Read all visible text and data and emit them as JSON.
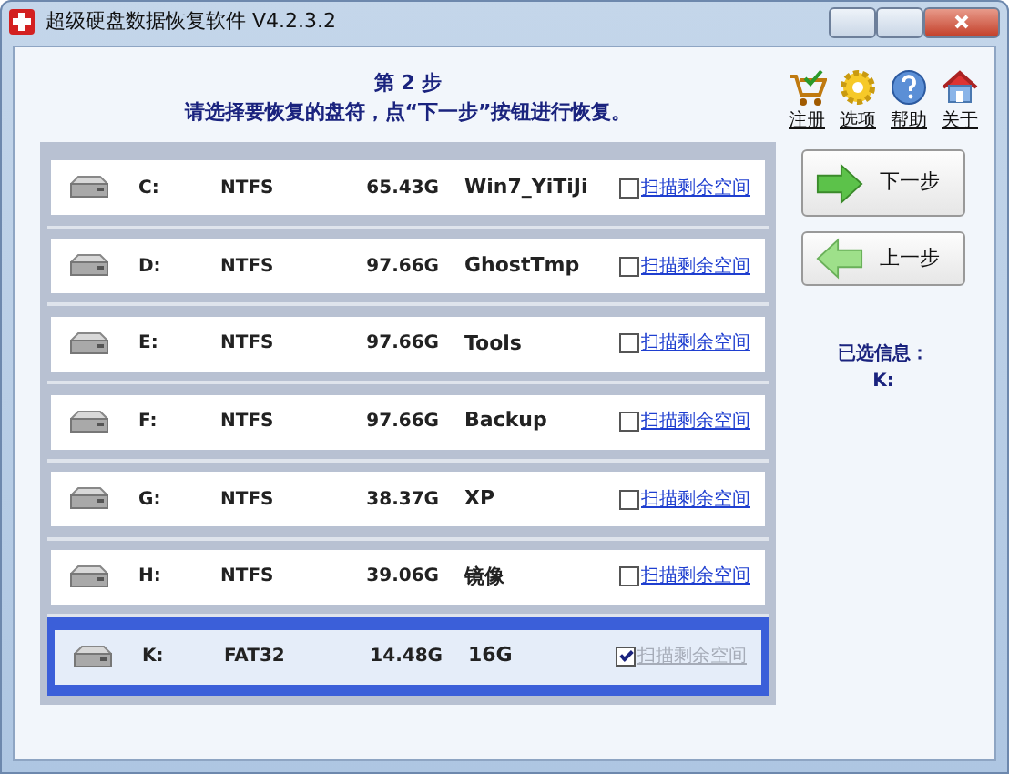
{
  "window": {
    "title": "超级硬盘数据恢复软件 V4.2.3.2"
  },
  "header": {
    "step": "第 2 步",
    "instruction": "请选择要恢复的盘符，点“下一步”按钮进行恢复。"
  },
  "toolbar": [
    {
      "kind": "cart",
      "label": "注册"
    },
    {
      "kind": "gear",
      "label": "选项"
    },
    {
      "kind": "help",
      "label": "帮助"
    },
    {
      "kind": "home",
      "label": "关于"
    }
  ],
  "drives": [
    {
      "letter": "C:",
      "filesystem": "NTFS",
      "size": "65.43G",
      "label": "Win7_YiTiJi",
      "selected": false,
      "scan_free_space": {
        "label": "扫描剩余空间",
        "checked": false,
        "disabled": false
      }
    },
    {
      "letter": "D:",
      "filesystem": "NTFS",
      "size": "97.66G",
      "label": "GhostTmp",
      "selected": false,
      "scan_free_space": {
        "label": "扫描剩余空间",
        "checked": false,
        "disabled": false
      }
    },
    {
      "letter": "E:",
      "filesystem": "NTFS",
      "size": "97.66G",
      "label": "Tools",
      "selected": false,
      "scan_free_space": {
        "label": "扫描剩余空间",
        "checked": false,
        "disabled": false
      }
    },
    {
      "letter": "F:",
      "filesystem": "NTFS",
      "size": "97.66G",
      "label": "Backup",
      "selected": false,
      "scan_free_space": {
        "label": "扫描剩余空间",
        "checked": false,
        "disabled": false
      }
    },
    {
      "letter": "G:",
      "filesystem": "NTFS",
      "size": "38.37G",
      "label": "XP",
      "selected": false,
      "scan_free_space": {
        "label": "扫描剩余空间",
        "checked": false,
        "disabled": false
      }
    },
    {
      "letter": "H:",
      "filesystem": "NTFS",
      "size": "39.06G",
      "label": "镜像",
      "selected": false,
      "scan_free_space": {
        "label": "扫描剩余空间",
        "checked": false,
        "disabled": false
      }
    },
    {
      "letter": "K:",
      "filesystem": "FAT32",
      "size": "14.48G",
      "label": "16G",
      "selected": true,
      "scan_free_space": {
        "label": "扫描剩余空间",
        "checked": true,
        "disabled": true
      }
    }
  ],
  "buttons": [
    {
      "kind": "next",
      "label": "下一步"
    },
    {
      "kind": "back",
      "label": "上一步"
    }
  ],
  "selection_info": {
    "title": "已选信息：",
    "value": "K:"
  }
}
